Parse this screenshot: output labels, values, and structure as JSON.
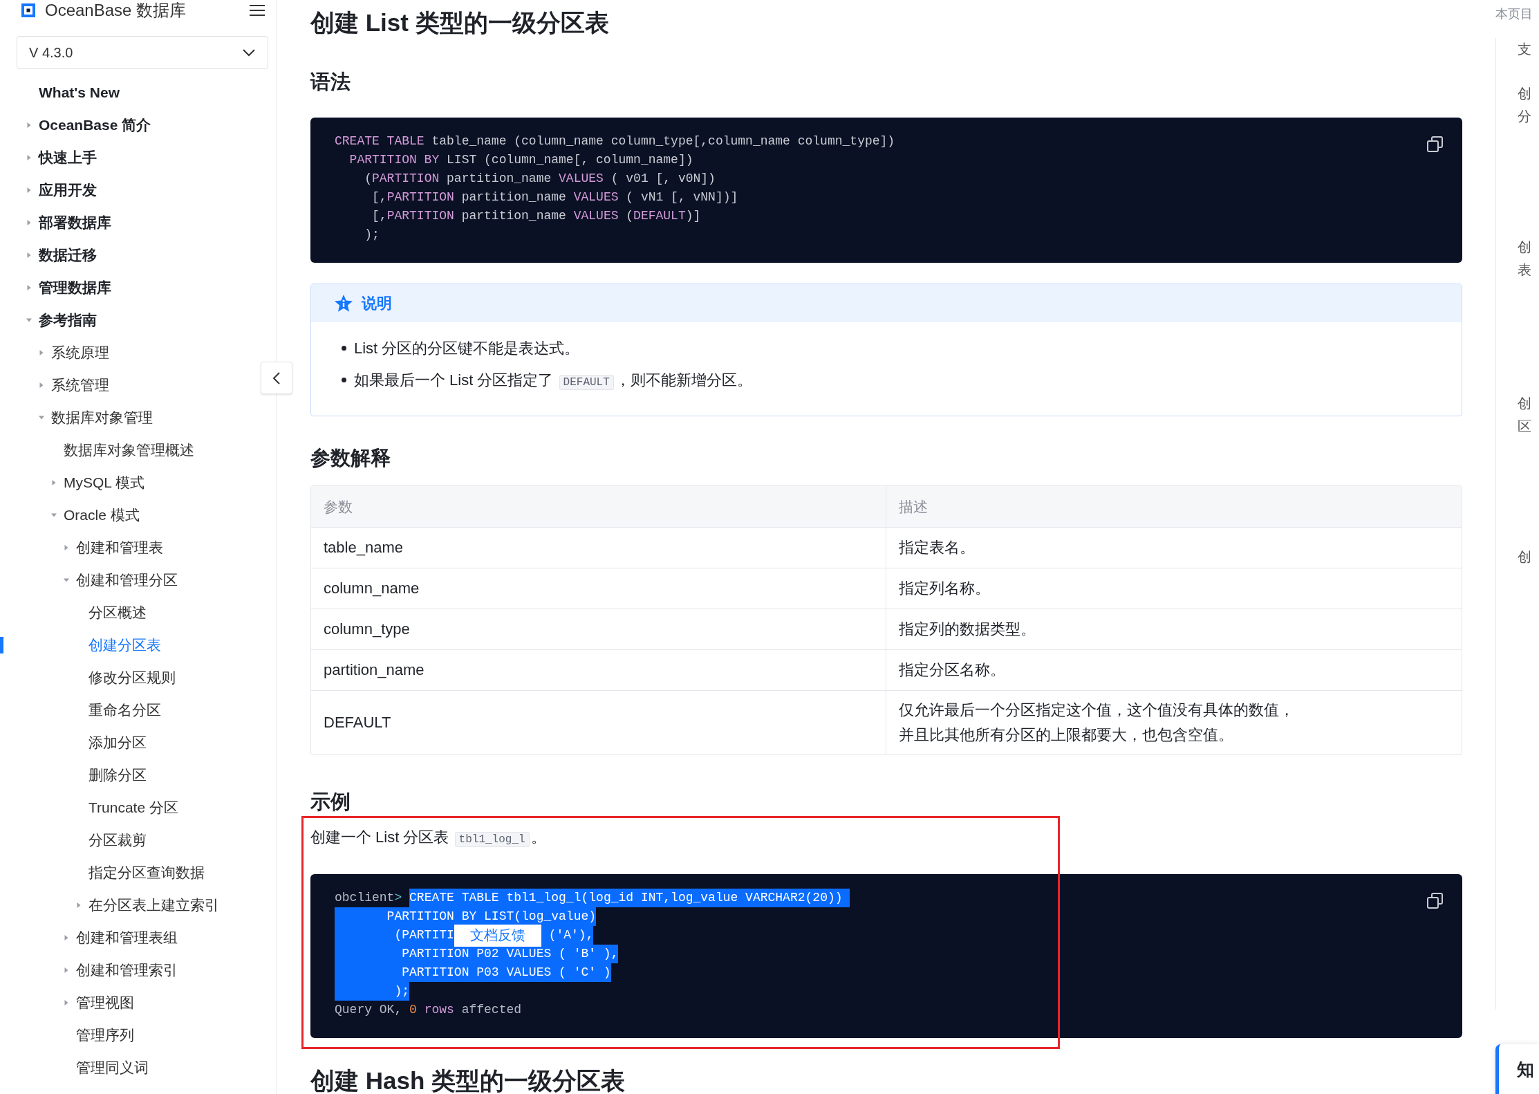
{
  "header": {
    "brand": "OceanBase 数据库"
  },
  "version_select": {
    "value": "V 4.3.0"
  },
  "nav": [
    {
      "label": "What's New",
      "selected": false
    },
    {
      "label": "OceanBase 简介",
      "expanded": false,
      "selected": false
    },
    {
      "label": "快速上手",
      "expanded": false,
      "selected": false
    },
    {
      "label": "应用开发",
      "expanded": false,
      "selected": false
    },
    {
      "label": "部署数据库",
      "expanded": false,
      "selected": false
    },
    {
      "label": "数据迁移",
      "expanded": false,
      "selected": false
    },
    {
      "label": "管理数据库",
      "expanded": false,
      "selected": false
    },
    {
      "label": "参考指南",
      "expanded": true,
      "selected": false,
      "children": [
        {
          "label": "系统原理",
          "expanded": false,
          "selected": false
        },
        {
          "label": "系统管理",
          "expanded": false,
          "selected": false
        },
        {
          "label": "数据库对象管理",
          "expanded": true,
          "selected": false,
          "children": [
            {
              "label": "数据库对象管理概述",
              "selected": false
            },
            {
              "label": "MySQL 模式",
              "expanded": false,
              "selected": false
            },
            {
              "label": "Oracle 模式",
              "expanded": true,
              "selected": false,
              "children": [
                {
                  "label": "创建和管理表",
                  "expanded": false,
                  "selected": false
                },
                {
                  "label": "创建和管理分区",
                  "expanded": true,
                  "selected": false,
                  "children": [
                    {
                      "label": "分区概述",
                      "selected": false
                    },
                    {
                      "label": "创建分区表",
                      "selected": true
                    },
                    {
                      "label": "修改分区规则",
                      "selected": false
                    },
                    {
                      "label": "重命名分区",
                      "selected": false
                    },
                    {
                      "label": "添加分区",
                      "selected": false
                    },
                    {
                      "label": "删除分区",
                      "selected": false
                    },
                    {
                      "label": "Truncate 分区",
                      "selected": false
                    },
                    {
                      "label": "分区裁剪",
                      "selected": false
                    },
                    {
                      "label": "指定分区查询数据",
                      "selected": false
                    },
                    {
                      "label": "在分区表上建立索引",
                      "expanded": false,
                      "selected": false
                    }
                  ]
                },
                {
                  "label": "创建和管理表组",
                  "expanded": false,
                  "selected": false
                },
                {
                  "label": "创建和管理索引",
                  "expanded": false,
                  "selected": false
                },
                {
                  "label": "管理视图",
                  "expanded": false,
                  "selected": false
                },
                {
                  "label": "管理序列",
                  "selected": false
                },
                {
                  "label": "管理同义词",
                  "selected": false
                }
              ]
            }
          ]
        }
      ]
    }
  ],
  "article": {
    "title": "创建 List 类型的一级分区表",
    "syntax_heading": "语法",
    "syntax_code": [
      [
        {
          "text": "CREATE TABLE",
          "kind": "keyword"
        },
        {
          "text": " table_name (column_name column_type[,column_name column_type])",
          "kind": "plain"
        }
      ],
      [
        {
          "text": "  PARTITION BY",
          "kind": "keyword"
        },
        {
          "text": " LIST (column_name[, column_name])",
          "kind": "plain"
        }
      ],
      [
        {
          "text": "    (",
          "kind": "plain"
        },
        {
          "text": "PARTITION",
          "kind": "keyword"
        },
        {
          "text": " partition_name ",
          "kind": "plain"
        },
        {
          "text": "VALUES",
          "kind": "keyword"
        },
        {
          "text": " ( v01 [, v0N])",
          "kind": "plain"
        }
      ],
      [
        {
          "text": "     [,",
          "kind": "plain"
        },
        {
          "text": "PARTITION",
          "kind": "keyword"
        },
        {
          "text": " partition_name ",
          "kind": "plain"
        },
        {
          "text": "VALUES",
          "kind": "keyword"
        },
        {
          "text": " ( vN1 [, vNN])]",
          "kind": "plain"
        }
      ],
      [
        {
          "text": "     [,",
          "kind": "plain"
        },
        {
          "text": "PARTITION",
          "kind": "keyword"
        },
        {
          "text": " partition_name ",
          "kind": "plain"
        },
        {
          "text": "VALUES",
          "kind": "keyword"
        },
        {
          "text": " (",
          "kind": "plain"
        },
        {
          "text": "DEFAULT",
          "kind": "keyword"
        },
        {
          "text": ")]",
          "kind": "plain"
        }
      ],
      [
        {
          "text": "    );",
          "kind": "plain"
        }
      ]
    ],
    "note": {
      "title": "说明",
      "items": [
        [
          {
            "text": "List 分区的分区键不能是表达式。",
            "kind": "text"
          }
        ],
        [
          {
            "text": "如果最后一个 List 分区指定了 ",
            "kind": "text"
          },
          {
            "text": "DEFAULT",
            "kind": "code"
          },
          {
            "text": "，则不能新增分区。",
            "kind": "text"
          }
        ]
      ]
    },
    "params_heading": "参数解释",
    "table": {
      "columns": [
        "参数",
        "描述"
      ],
      "rows": [
        {
          "cells": [
            [
              "table_name"
            ],
            [
              "指定表名。"
            ]
          ]
        },
        {
          "cells": [
            [
              "column_name"
            ],
            [
              "指定列名称。"
            ]
          ]
        },
        {
          "cells": [
            [
              "column_type"
            ],
            [
              "指定列的数据类型。"
            ]
          ]
        },
        {
          "cells": [
            [
              "partition_name"
            ],
            [
              "指定分区名称。"
            ]
          ]
        },
        {
          "cells": [
            [
              "DEFAULT"
            ],
            [
              "仅允许最后一个分区指定这个值，这个值没有具体的数值，",
              "并且比其他所有分区的上限都要大，也包含空值。"
            ]
          ]
        }
      ]
    },
    "example_heading": "示例",
    "example_text": [
      {
        "text": "创建一个 List 分区表 ",
        "kind": "text"
      },
      {
        "text": "tbl1_log_l",
        "kind": "code"
      },
      {
        "text": "。",
        "kind": "text"
      }
    ],
    "example_code": [
      [
        {
          "text": "obclient",
          "kind": "prompt",
          "selected": false
        },
        {
          "text": "> ",
          "kind": "prompt-mark",
          "selected": false
        },
        {
          "text": "CREATE TABLE tbl1_log_l(log_id INT,log_value VARCHAR2(20)) ",
          "kind": "plain",
          "selected": true
        }
      ],
      [
        {
          "text": "       PARTITION BY LIST(log_value)",
          "kind": "plain",
          "selected": true
        }
      ],
      [
        {
          "text": "        (PARTITI",
          "kind": "plain",
          "selected": true
        },
        {
          "text": "文档反馈",
          "kind": "popup"
        },
        {
          "text": " ('A'),",
          "kind": "plain",
          "selected": true
        }
      ],
      [
        {
          "text": "         PARTITION P02 VALUES ( 'B' ),",
          "kind": "plain",
          "selected": true
        }
      ],
      [
        {
          "text": "         PARTITION P03 VALUES ( 'C' )",
          "kind": "plain",
          "selected": true
        }
      ],
      [
        {
          "text": "        );",
          "kind": "plain",
          "selected": true
        }
      ],
      [
        {
          "text": "Query OK, ",
          "kind": "prompt",
          "selected": false
        },
        {
          "text": "0",
          "kind": "number",
          "selected": false
        },
        {
          "text": " rows",
          "kind": "keyword",
          "selected": false
        },
        {
          "text": " affected",
          "kind": "prompt",
          "selected": false
        }
      ]
    ],
    "next_heading": "创建 Hash 类型的一级分区表"
  },
  "toc": {
    "title": "本页目",
    "items": [
      {
        "lines": [
          "支"
        ]
      },
      {
        "lines": [
          "创",
          "分"
        ]
      },
      {
        "lines": [
          "创",
          "表"
        ]
      },
      {
        "lines": [
          "创",
          "区"
        ]
      },
      {
        "lines": [
          "创"
        ]
      }
    ]
  },
  "side_card": {
    "text": "知"
  }
}
